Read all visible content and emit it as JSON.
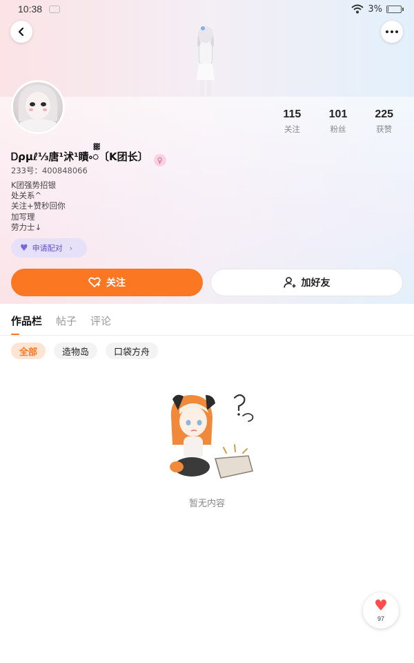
{
  "status_bar": {
    "time": "10:38",
    "battery": "3%",
    "battery_level": 0.03
  },
  "profile": {
    "stats": [
      {
        "value": "115",
        "label": "关注"
      },
      {
        "value": "101",
        "label": "粉丝"
      },
      {
        "value": "225",
        "label": "获赞"
      }
    ],
    "username": "Ꭰρμℓ⅓唐¹沭¹瞔༚ᢆ〔K团长〕",
    "uid": "233号：400848066",
    "bio": "K团强势招银\n处关系^\n关注+赞秒回你\n加写理\n劳力士↓",
    "cp_button": "申请配对",
    "follow_button": "关注",
    "add_friend_button": "加好友"
  },
  "tabs": [
    {
      "label": "作品栏"
    },
    {
      "label": "帖子"
    },
    {
      "label": "评论"
    }
  ],
  "chips": [
    {
      "label": "全部"
    },
    {
      "label": "造物岛"
    },
    {
      "label": "口袋方舟"
    }
  ],
  "empty_state": {
    "text": "暂无内容"
  },
  "like_fab": {
    "count": "97"
  },
  "colors": {
    "accent": "#fb7722",
    "cp": "#6650c8",
    "heart": "#ff4d4d"
  }
}
